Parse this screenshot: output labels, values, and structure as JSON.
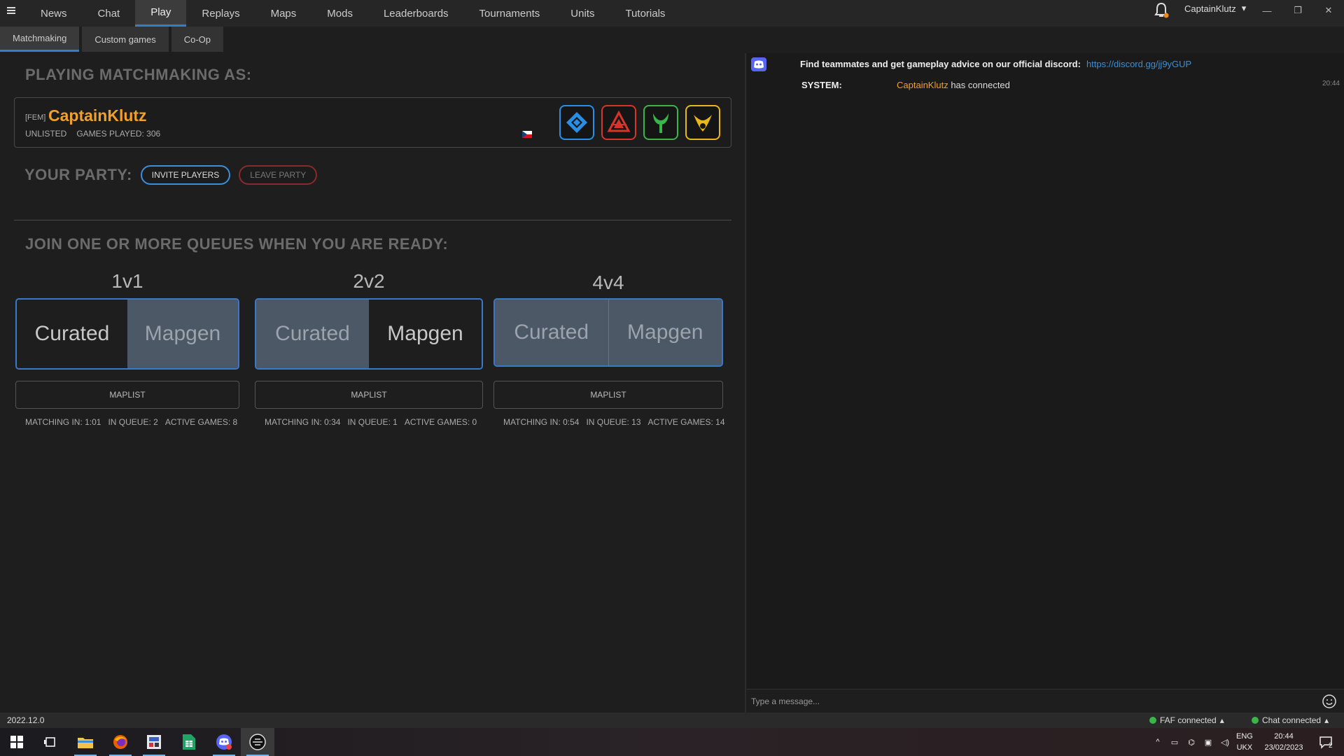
{
  "nav": {
    "items": [
      "News",
      "Chat",
      "Play",
      "Replays",
      "Maps",
      "Mods",
      "Leaderboards",
      "Tournaments",
      "Units",
      "Tutorials"
    ],
    "active": "Play"
  },
  "user_menu": {
    "username": "CaptainKlutz"
  },
  "subtabs": [
    "Matchmaking",
    "Custom games",
    "Co-Op"
  ],
  "matchmaking": {
    "heading": "PLAYING MATCHMAKING AS:",
    "player": {
      "clan": "[FEM]",
      "name": "CaptainKlutz",
      "rank": "UNLISTED",
      "games_played": "GAMES PLAYED: 306"
    },
    "factions": [
      {
        "name": "uef-faction-icon",
        "color": "#2a8ee6"
      },
      {
        "name": "cybran-faction-icon",
        "color": "#d8352a"
      },
      {
        "name": "aeon-faction-icon",
        "color": "#3ab54a"
      },
      {
        "name": "seraphim-faction-icon",
        "color": "#e8b81a"
      }
    ],
    "party_heading": "YOUR PARTY:",
    "invite_label": "INVITE PLAYERS",
    "leave_label": "LEAVE PARTY",
    "queues_heading": "JOIN ONE OR MORE QUEUES WHEN YOU ARE READY:",
    "queues": [
      {
        "title": "1v1",
        "curated": "Curated",
        "mapgen": "Mapgen",
        "maplist": "MAPLIST",
        "matching": "MATCHING IN: 1:01",
        "in_queue": "IN QUEUE: 2",
        "active_games": "ACTIVE GAMES: 8"
      },
      {
        "title": "2v2",
        "curated": "Curated",
        "mapgen": "Mapgen",
        "maplist": "MAPLIST",
        "matching": "MATCHING IN: 0:34",
        "in_queue": "IN QUEUE: 1",
        "active_games": "ACTIVE GAMES: 0"
      },
      {
        "title": "4v4",
        "curated": "Curated",
        "mapgen": "Mapgen",
        "maplist": "MAPLIST",
        "matching": "MATCHING IN: 0:54",
        "in_queue": "IN QUEUE: 13",
        "active_games": "ACTIVE GAMES: 14"
      }
    ]
  },
  "chat": {
    "discord_text": "Find teammates and get gameplay advice on our official discord:",
    "discord_link": "https://discord.gg/jj9yGUP",
    "system_label": "SYSTEM:",
    "system_user": "CaptainKlutz",
    "system_text": " has connected",
    "time": "20:44",
    "input_placeholder": "Type a message..."
  },
  "status": {
    "version": "2022.12.0",
    "faf": "FAF connected",
    "chat": "Chat connected"
  },
  "taskbar": {
    "lang1": "ENG",
    "lang2": "UKX",
    "time": "20:44",
    "date": "23/02/2023",
    "notif_count": "2"
  },
  "colors": {
    "accent": "#2f80c8",
    "player_name": "#f0a02c",
    "connected": "#3ab54a"
  }
}
